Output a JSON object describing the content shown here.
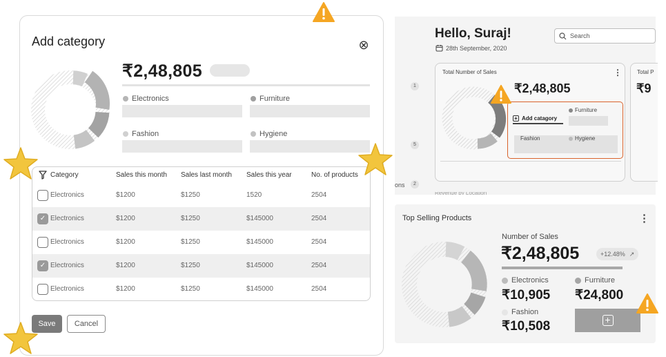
{
  "modal": {
    "title": "Add category",
    "close_icon": "⊗",
    "total_amount": "₹2,48,805",
    "legend": [
      {
        "label": "Electronics",
        "color": "#b5b5b5"
      },
      {
        "label": "Furniture",
        "color": "#a0a0a0"
      },
      {
        "label": "Fashion",
        "color": "#d0d0d0"
      },
      {
        "label": "Hygiene",
        "color": "#c2c2c2"
      }
    ],
    "table": {
      "headers": [
        "Category",
        "Sales this month",
        "Sales last month",
        "Sales this year",
        "No. of products"
      ],
      "rows": [
        {
          "checked": false,
          "cells": [
            "Electronics",
            "$1200",
            "$1250",
            "1520",
            "2504"
          ]
        },
        {
          "checked": true,
          "cells": [
            "Electronics",
            "$1200",
            "$1250",
            "$145000",
            "2504"
          ]
        },
        {
          "checked": false,
          "cells": [
            "Electronics",
            "$1200",
            "$1250",
            "$145000",
            "2504"
          ]
        },
        {
          "checked": true,
          "cells": [
            "Electronics",
            "$1200",
            "$1250",
            "$145000",
            "2504"
          ]
        },
        {
          "checked": false,
          "cells": [
            "Electronics",
            "$1200",
            "$1250",
            "$145000",
            "2504"
          ]
        }
      ]
    },
    "save_label": "Save",
    "cancel_label": "Cancel"
  },
  "dashboard": {
    "greeting": "Hello, Suraj!",
    "date": "28th September, 2020",
    "search_placeholder": "Search",
    "card_title": "Total Number of Sales",
    "card2_title": "Total P",
    "card_amount": "₹2,48,805",
    "card2_amount": "₹9",
    "menu_icon": "⋮",
    "side_numbers": [
      "1",
      "5",
      "2"
    ],
    "side_label": "ons",
    "popup": {
      "add_label": "Add catagory",
      "items": [
        "Furniture",
        "Fashion",
        "Hygiene"
      ]
    },
    "bottom_cut_label": "Revenue by Location"
  },
  "top_selling": {
    "title": "Top Selling Products",
    "number_label": "Number of Sales",
    "amount": "₹2,48,805",
    "change": "+12.48%",
    "change_icon": "↗",
    "items": [
      {
        "label": "Electronics",
        "value": "₹10,905"
      },
      {
        "label": "Furniture",
        "value": "₹24,800"
      },
      {
        "label": "Fashion",
        "value": "₹10,508"
      }
    ],
    "plus_icon": "+"
  },
  "annotations": {
    "warning_icon": "!",
    "star_icon": "★"
  }
}
